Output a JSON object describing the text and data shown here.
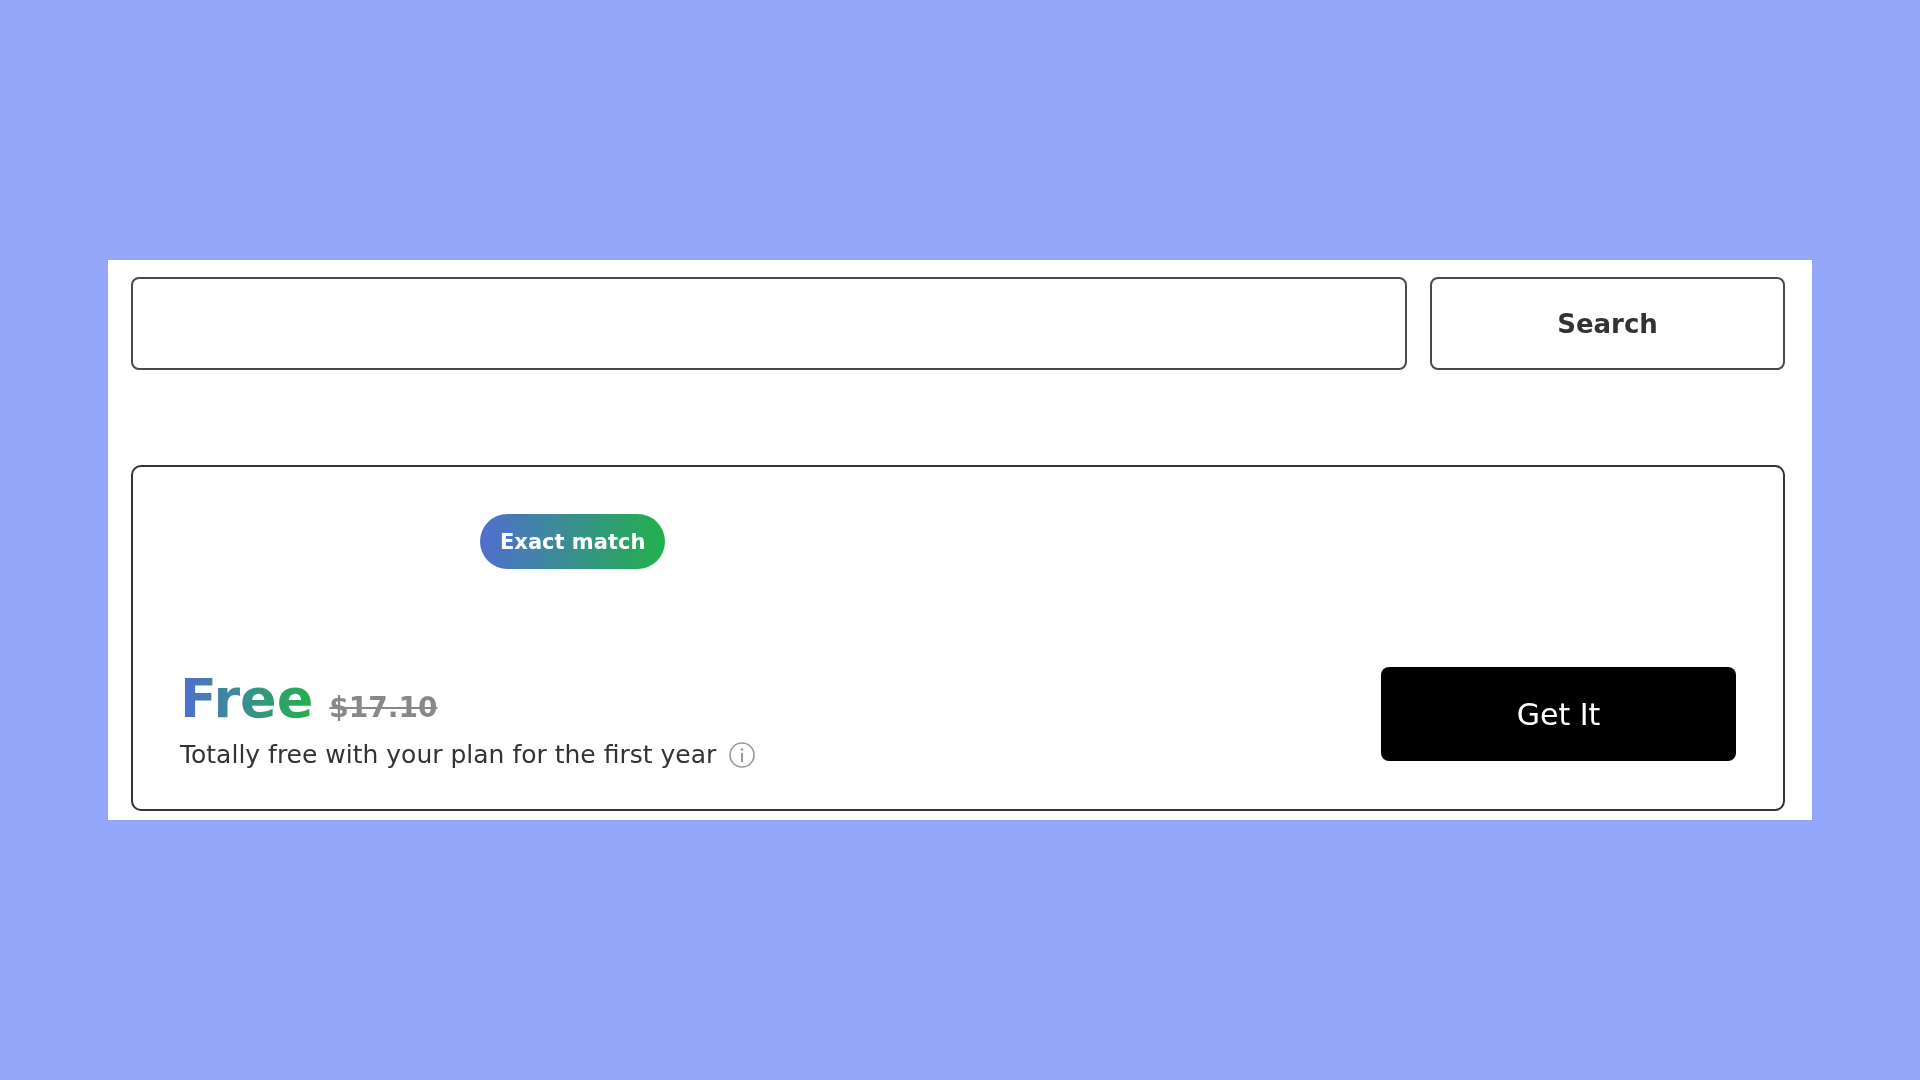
{
  "search": {
    "button": "Search"
  },
  "result": {
    "badge": "Exact match",
    "price": "Free",
    "original_price": "$17.10",
    "note": "Totally free with your plan for the first year",
    "button": "Get It"
  }
}
